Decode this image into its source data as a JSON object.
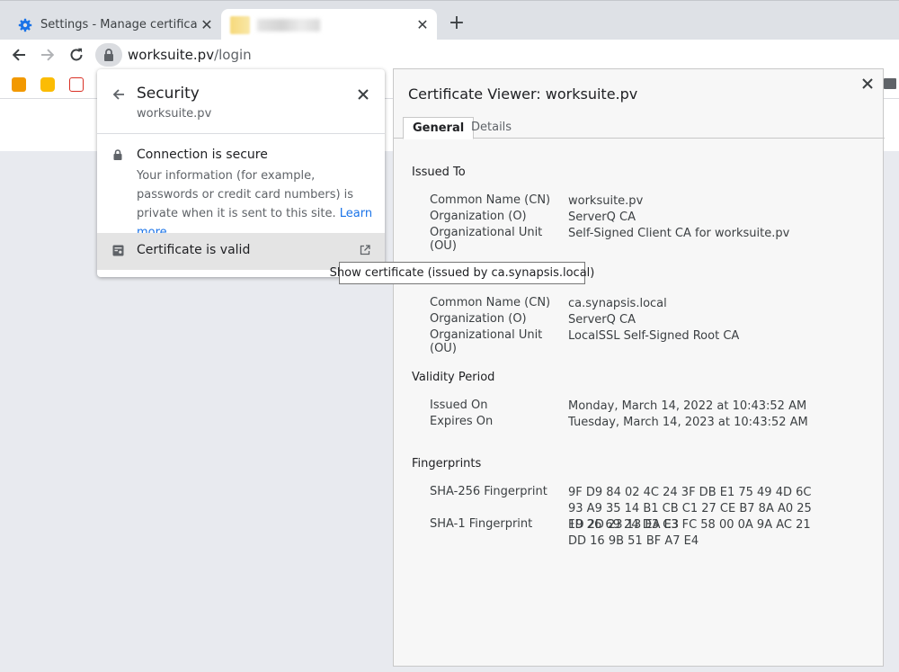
{
  "browser": {
    "tabs": [
      {
        "title": "Settings - Manage certificates",
        "icon": "gear-icon"
      },
      {
        "title": "",
        "icon": "blurred-favicon"
      }
    ],
    "url_host": "worksuite.pv",
    "url_path": "/login"
  },
  "security_popup": {
    "title": "Security",
    "subtitle": "worksuite.pv",
    "connection_title": "Connection is secure",
    "connection_desc": "Your information (for example, passwords or credit card numbers) is private when it is sent to this site.",
    "learn_more": "Learn more",
    "certificate_label": "Certificate is valid"
  },
  "tooltip": "Show certificate (issued by ca.synapsis.local)",
  "viewer": {
    "title": "Certificate Viewer: worksuite.pv",
    "tabs": [
      "General",
      "Details"
    ],
    "issued_to": {
      "heading": "Issued To",
      "rows": [
        {
          "k": "Common Name (CN)",
          "v": "worksuite.pv"
        },
        {
          "k": "Organization (O)",
          "v": "ServerQ CA"
        },
        {
          "k": "Organizational Unit (OU)",
          "v": "Self-Signed Client CA for worksuite.pv"
        }
      ]
    },
    "issued_by": {
      "rows": [
        {
          "k": "Common Name (CN)",
          "v": "ca.synapsis.local"
        },
        {
          "k": "Organization (O)",
          "v": "ServerQ CA"
        },
        {
          "k": "Organizational Unit (OU)",
          "v": "LocalSSL Self-Signed Root CA"
        }
      ]
    },
    "validity": {
      "heading": "Validity Period",
      "rows": [
        {
          "k": "Issued On",
          "v": "Monday, March 14, 2022 at 10:43:52 AM"
        },
        {
          "k": "Expires On",
          "v": "Tuesday, March 14, 2023 at 10:43:52 AM"
        }
      ]
    },
    "fingerprints": {
      "heading": "Fingerprints",
      "rows": [
        {
          "k": "SHA-256 Fingerprint",
          "v": "9F D9 84 02 4C 24 3F DB E1 75 49 4D 6C 93 A9 35 14 B1 CB C1 27 CE B7 8A A0 25 FD 2D 23 13 EA E3"
        },
        {
          "k": "SHA-1 Fingerprint",
          "v": "19 26 69 24 D3 C3 FC 58 00 0A 9A AC 21 DD 16 9B 51 BF A7 E4"
        }
      ]
    }
  },
  "colors": {
    "accent": "#1a73e8",
    "tabstrip": "#dee1e6",
    "page_bg": "#e8eaef"
  }
}
